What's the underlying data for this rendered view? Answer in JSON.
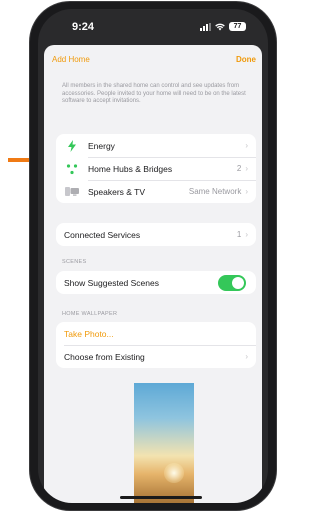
{
  "status_bar": {
    "time": "9:24",
    "battery": "77"
  },
  "nav": {
    "left_label": "Add Home",
    "right_label": "Done"
  },
  "description": "All members in the shared home can control and see updates from accessories. People invited to your home will need to be on the latest software to accept invitations.",
  "rows_group1": [
    {
      "label": "Energy",
      "value": "",
      "icon": "bolt-icon"
    },
    {
      "label": "Home Hubs & Bridges",
      "value": "2",
      "icon": "hub-icon"
    },
    {
      "label": "Speakers & TV",
      "value": "Same Network",
      "icon": "speaker-tv-icon"
    }
  ],
  "connected_services": {
    "label": "Connected Services",
    "value": "1"
  },
  "scenes": {
    "header": "SCENES",
    "show_suggested_label": "Show Suggested Scenes",
    "toggle_on": true
  },
  "wallpaper": {
    "header": "HOME WALLPAPER",
    "take_photo_label": "Take Photo...",
    "choose_existing_label": "Choose from Existing"
  },
  "colors": {
    "accent": "#f09a0b",
    "toggle_on": "#34c759",
    "annotation_arrow": "#f07a14",
    "energy_green": "#34c759"
  }
}
